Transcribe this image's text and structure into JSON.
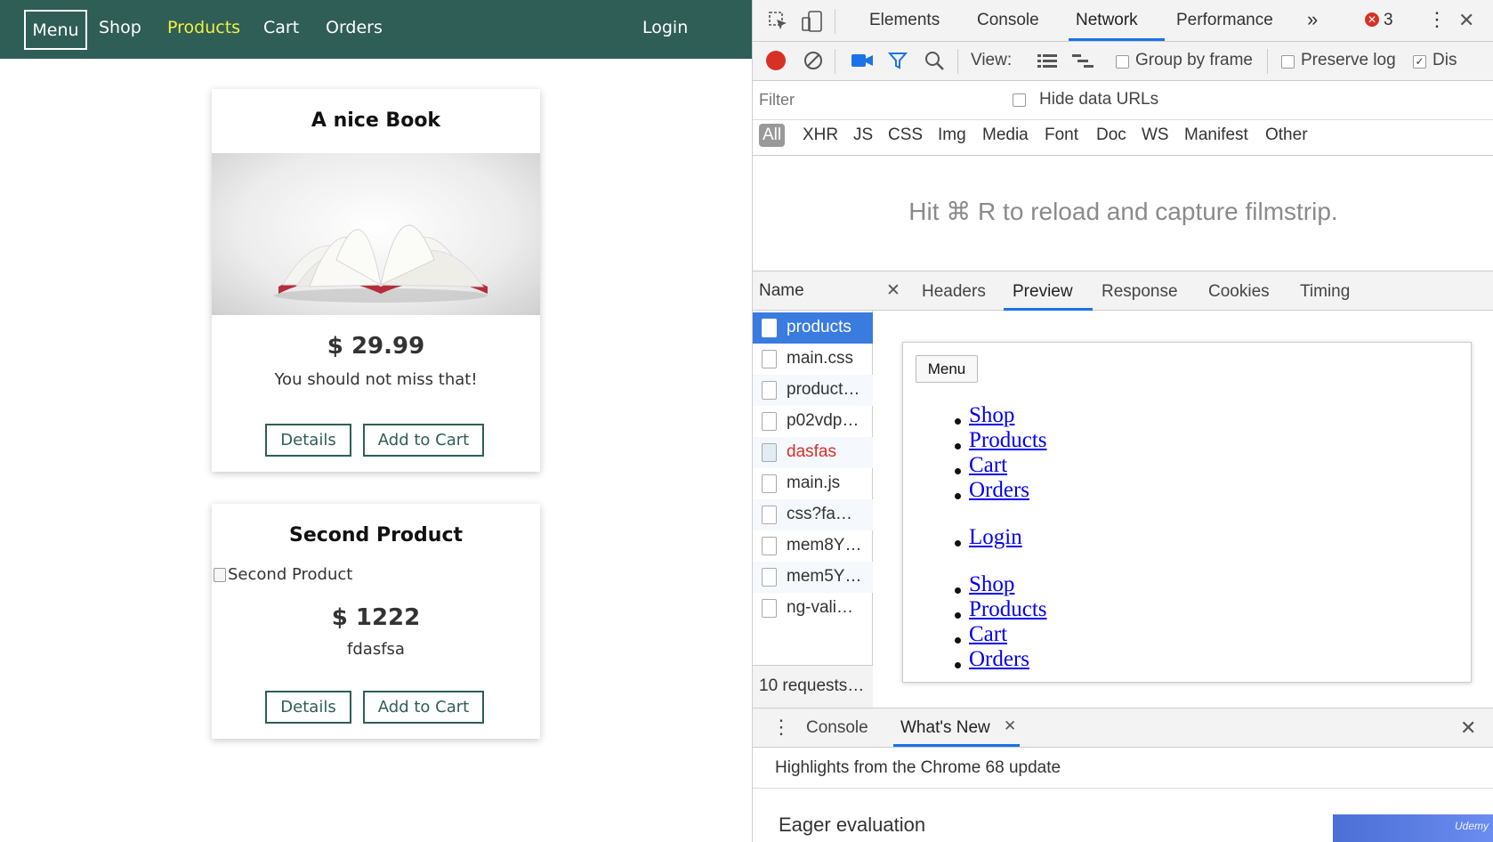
{
  "app": {
    "nav": {
      "menu_label": "Menu",
      "links": [
        "Shop",
        "Products",
        "Cart",
        "Orders"
      ],
      "active_link": "Products",
      "login_label": "Login"
    },
    "products": [
      {
        "title": "A nice Book",
        "price": "$ 29.99",
        "description": "You should not miss that!",
        "details_label": "Details",
        "add_label": "Add to Cart"
      },
      {
        "title": "Second Product",
        "image_alt": "Second Product",
        "price": "$ 1222",
        "description": "fdasfsa",
        "details_label": "Details",
        "add_label": "Add to Cart"
      }
    ]
  },
  "devtools": {
    "tabs": [
      "Elements",
      "Console",
      "Network",
      "Performance"
    ],
    "active_tab": "Network",
    "more_tabs": "»",
    "error_count": "3",
    "toolbar": {
      "view_label": "View:",
      "group_by_frame": "Group by frame",
      "preserve_log": "Preserve log",
      "disable_cache_cut": "Dis"
    },
    "filter": {
      "placeholder": "Filter",
      "hide_data_urls": "Hide data URLs"
    },
    "types": [
      "All",
      "XHR",
      "JS",
      "CSS",
      "Img",
      "Media",
      "Font",
      "Doc",
      "WS",
      "Manifest",
      "Other"
    ],
    "filmstrip_message": "Hit ⌘ R to reload and capture filmstrip.",
    "requests": {
      "header": "Name",
      "items": [
        "products",
        "main.css",
        "product…",
        "p02vdp…",
        "dasfas",
        "main.js",
        "css?fa…",
        "mem8Y…",
        "mem5Y…",
        "ng-vali…"
      ],
      "selected": "products",
      "error_item": "dasfas",
      "footer": "10 requests…"
    },
    "detail_tabs": [
      "Headers",
      "Preview",
      "Response",
      "Cookies",
      "Timing"
    ],
    "active_detail_tab": "Preview",
    "preview": {
      "menu_label": "Menu",
      "list1": [
        "Shop",
        "Products",
        "Cart",
        "Orders"
      ],
      "list2": [
        "Login"
      ],
      "list3": [
        "Shop",
        "Products",
        "Cart",
        "Orders"
      ]
    },
    "drawer": {
      "tabs": [
        "Console",
        "What's New"
      ],
      "active": "What's New",
      "highlights": "Highlights from the Chrome 68 update",
      "eager": "Eager evaluation",
      "banner_text": "Udemy"
    }
  },
  "colors": {
    "nav_bg": "#2e5e56",
    "nav_active": "#f4f03f",
    "button_border": "#2e5e56",
    "devtools_accent": "#1a73e8",
    "selected_row": "#3a7be0",
    "error_text": "#d93025",
    "record_red": "#d93025"
  }
}
